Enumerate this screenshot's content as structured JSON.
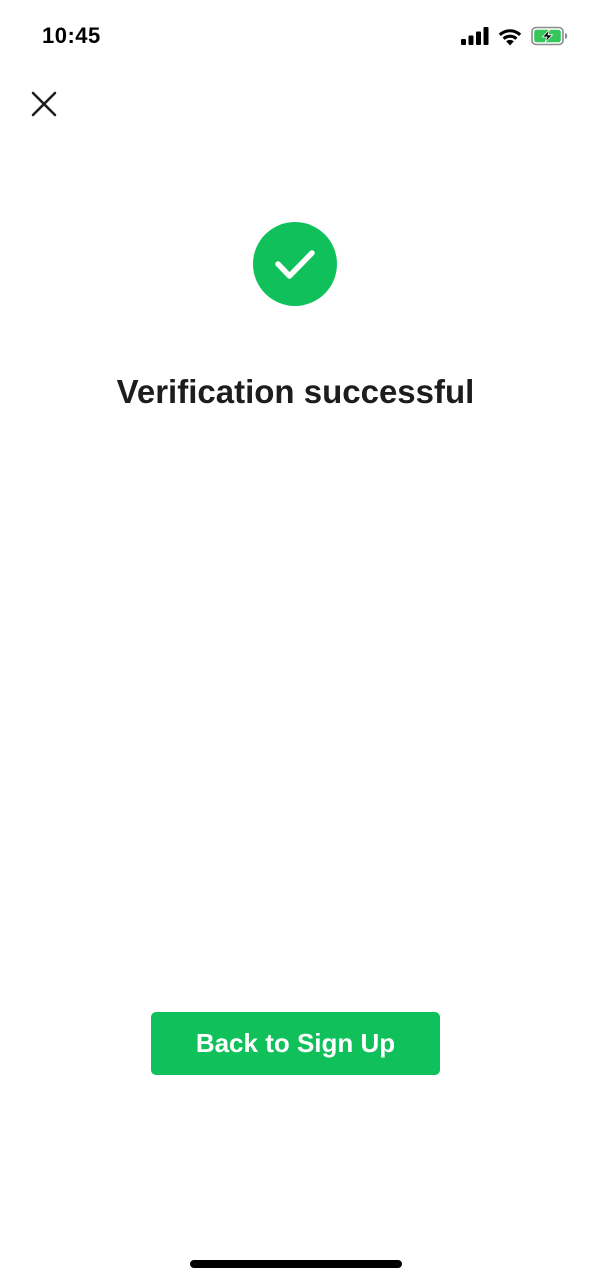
{
  "status_bar": {
    "time": "10:45",
    "icons": [
      "signal-icon",
      "wifi-icon",
      "battery-charging-icon"
    ]
  },
  "close": {
    "icon": "close-icon"
  },
  "success": {
    "icon": "checkmark-icon",
    "title": "Verification successful"
  },
  "actions": {
    "back_label": "Back to Sign Up"
  },
  "colors": {
    "accent": "#10C15B",
    "text": "#1D1D1F",
    "background": "#FFFFFF",
    "battery_fill": "#34C759"
  }
}
